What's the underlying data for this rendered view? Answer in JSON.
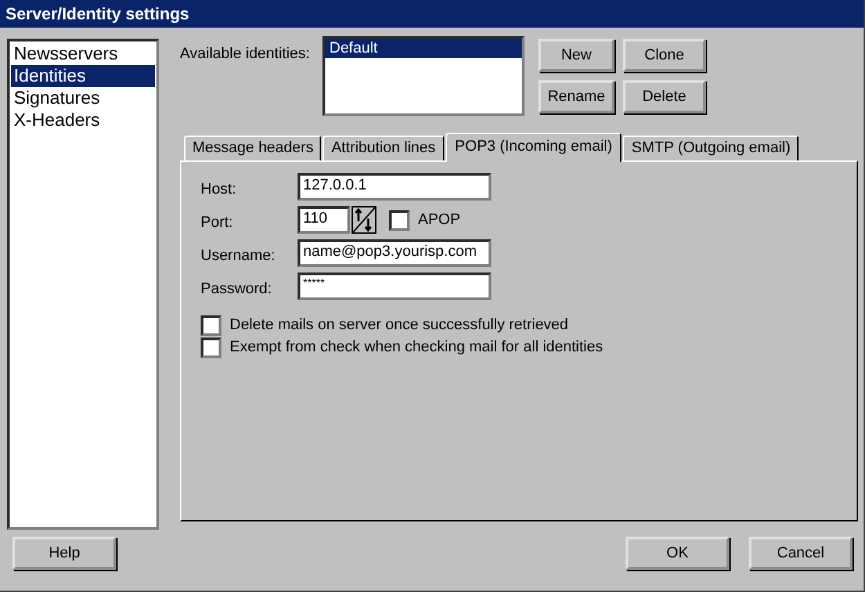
{
  "window": {
    "title": "Server/Identity settings"
  },
  "sidebar": {
    "items": [
      {
        "label": "Newsservers",
        "selected": false
      },
      {
        "label": "Identities",
        "selected": true
      },
      {
        "label": "Signatures",
        "selected": false
      },
      {
        "label": "X-Headers",
        "selected": false
      }
    ]
  },
  "identities": {
    "label": "Available identities:",
    "items": [
      {
        "label": "Default",
        "selected": true
      }
    ]
  },
  "identity_buttons": [
    "New",
    "Clone",
    "Rename",
    "Delete"
  ],
  "tabs": [
    {
      "label": "Message headers",
      "selected": false
    },
    {
      "label": "Attribution lines",
      "selected": false
    },
    {
      "label": "POP3 (Incoming email)",
      "selected": true
    },
    {
      "label": "SMTP (Outgoing email)",
      "selected": false
    }
  ],
  "pop3": {
    "host": {
      "label": "Host:",
      "value": "127.0.0.1"
    },
    "port": {
      "label": "Port:",
      "value": "110"
    },
    "apop": {
      "label": "APOP",
      "checked": false
    },
    "username": {
      "label": "Username:",
      "value": "name@pop3.yourisp.com"
    },
    "password": {
      "label": "Password:",
      "value": "*****"
    },
    "options": [
      {
        "label": "Delete mails on server once successfully retrieved",
        "checked": false
      },
      {
        "label": "Exempt from check when checking mail for all identities",
        "checked": false
      }
    ]
  },
  "buttons": {
    "help": "Help",
    "ok": "OK",
    "cancel": "Cancel"
  }
}
